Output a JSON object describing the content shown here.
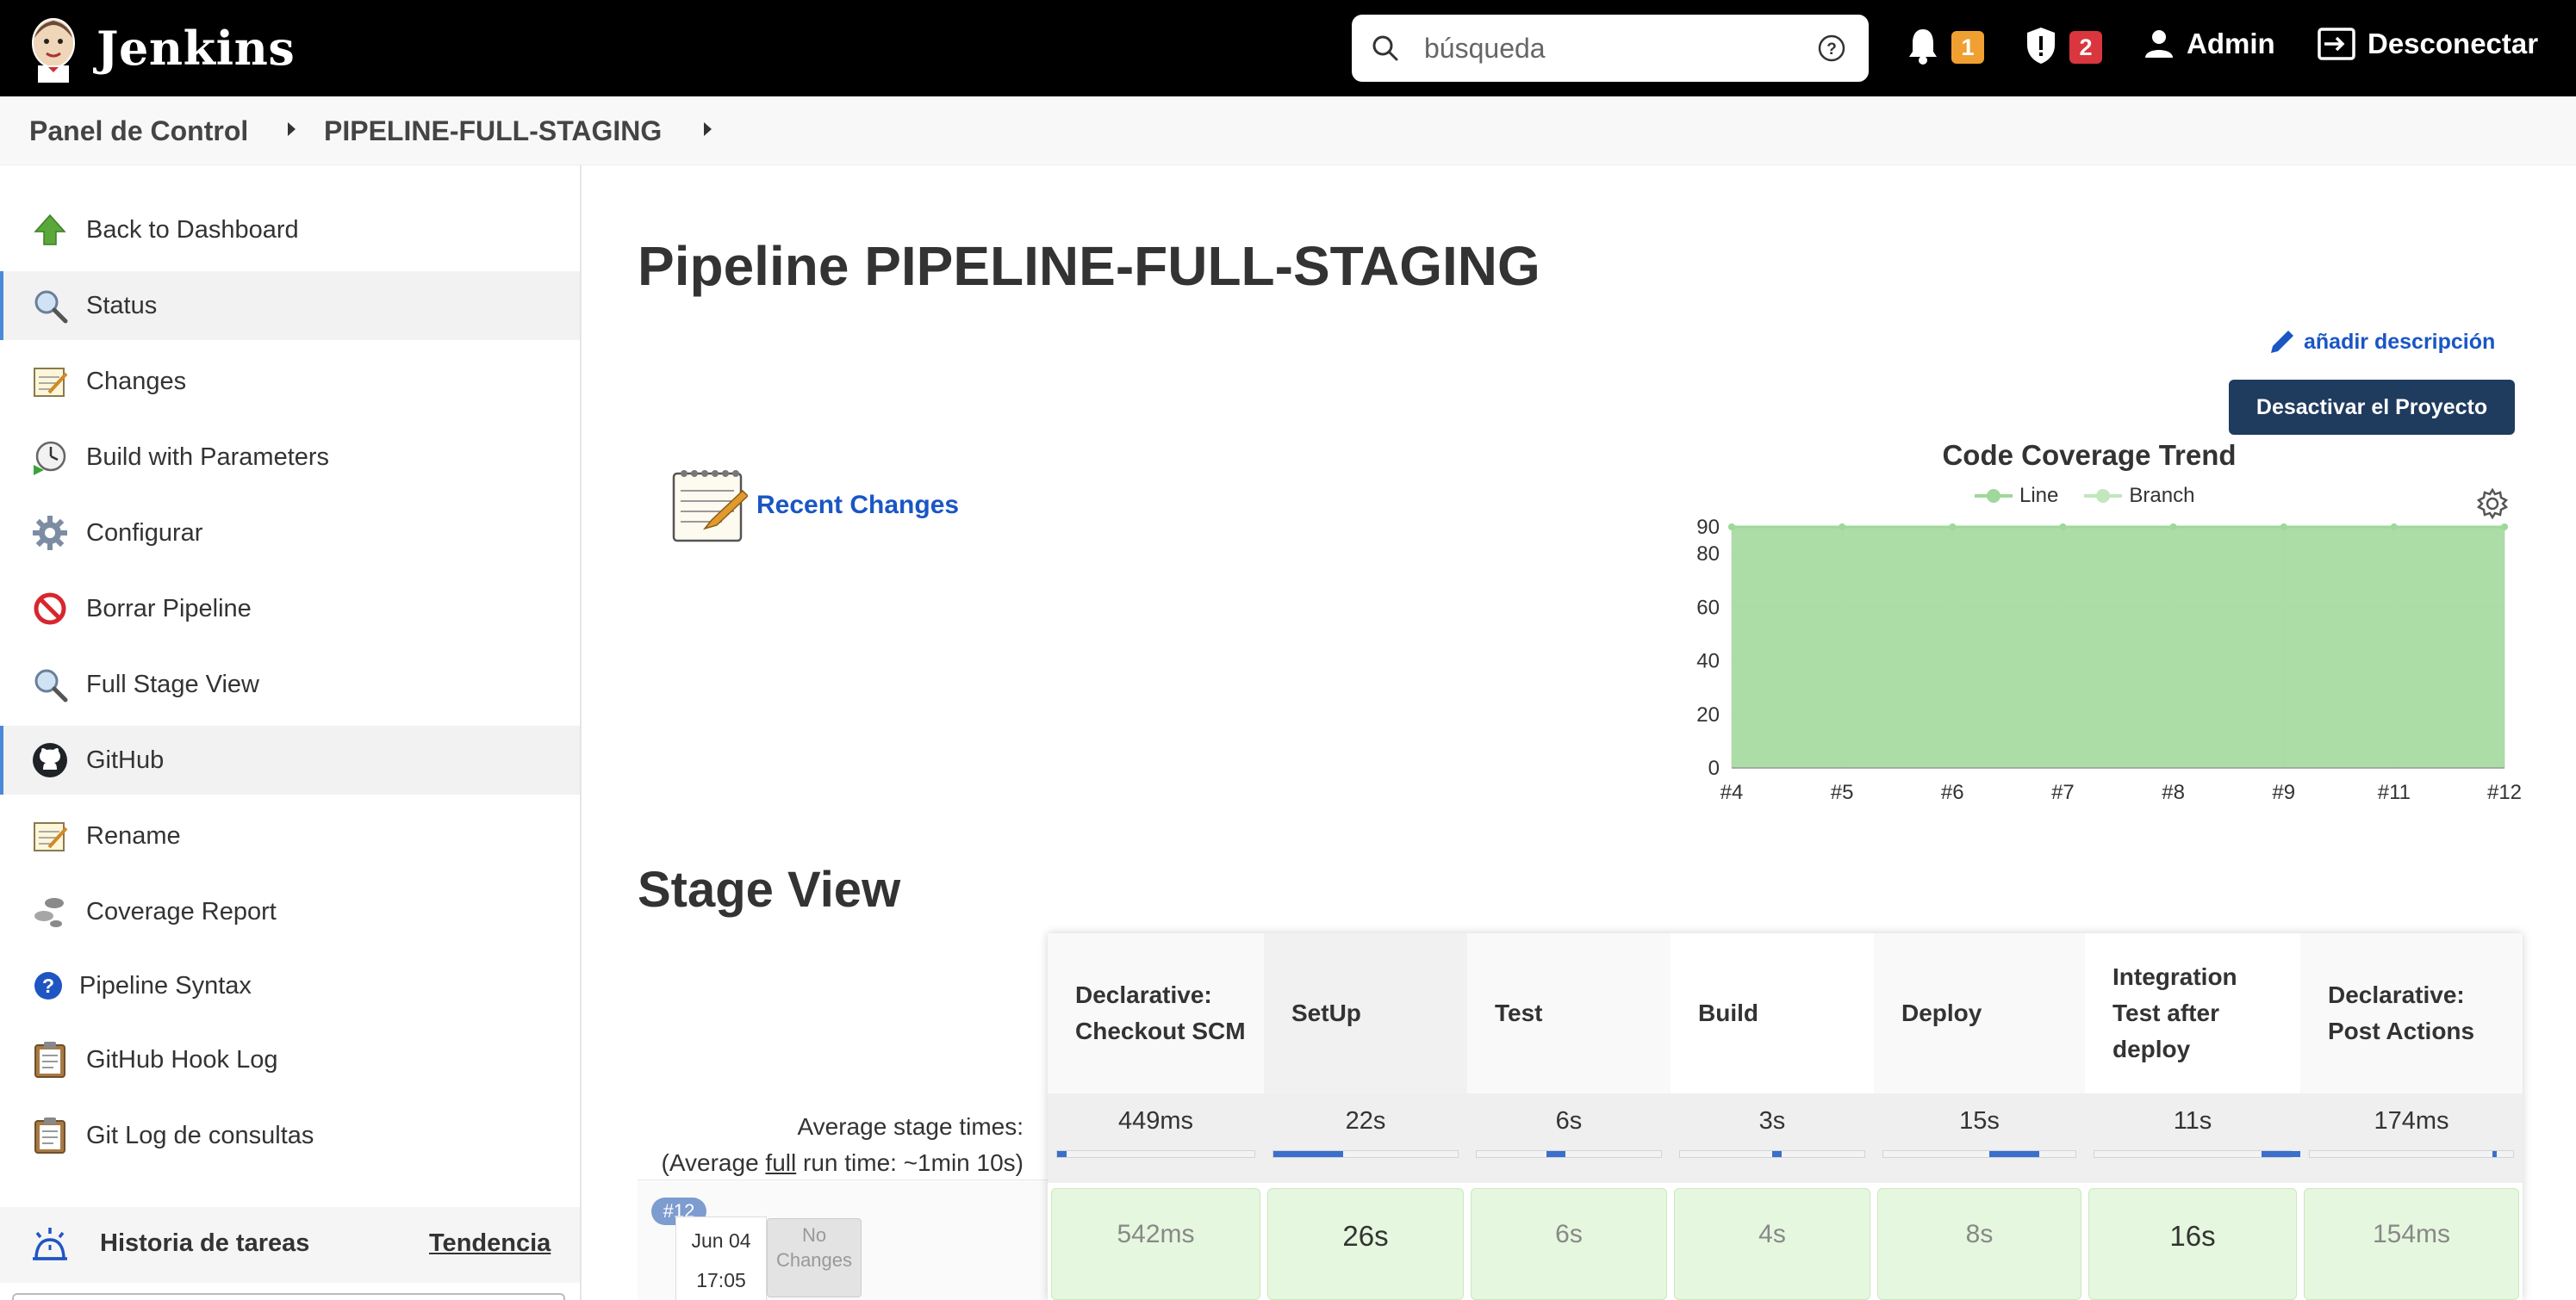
{
  "header": {
    "logo_text": "Jenkins",
    "search_placeholder": "búsqueda",
    "notifications_count": "1",
    "security_count": "2",
    "user_label": "Admin",
    "logout_label": "Desconectar",
    "notifications_color": "#f0a030",
    "security_color": "#d9363e"
  },
  "breadcrumb": {
    "items": [
      "Panel de Control",
      "PIPELINE-FULL-STAGING"
    ]
  },
  "sidebar": {
    "items": [
      {
        "label": "Back to Dashboard",
        "icon": "arrow-up-icon"
      },
      {
        "label": "Status",
        "icon": "magnifier-icon"
      },
      {
        "label": "Changes",
        "icon": "notepad-icon"
      },
      {
        "label": "Build with Parameters",
        "icon": "clock-build-icon"
      },
      {
        "label": "Configurar",
        "icon": "gear-icon"
      },
      {
        "label": "Borrar Pipeline",
        "icon": "no-entry-icon"
      },
      {
        "label": "Full Stage View",
        "icon": "magnifier-icon"
      },
      {
        "label": "GitHub",
        "icon": "github-icon"
      },
      {
        "label": "Rename",
        "icon": "notepad-icon"
      },
      {
        "label": "Coverage Report",
        "icon": "footprints-icon"
      },
      {
        "label": "Pipeline Syntax",
        "icon": "help-icon"
      },
      {
        "label": "GitHub Hook Log",
        "icon": "clipboard-icon"
      },
      {
        "label": "Git Log de consultas",
        "icon": "clipboard-icon"
      }
    ],
    "history_title": "Historia de tareas",
    "history_trend": "Tendencia"
  },
  "main": {
    "title": "Pipeline PIPELINE-FULL-STAGING",
    "add_description": "añadir descripción",
    "disable_button": "Desactivar el Proyecto",
    "recent_changes": "Recent Changes"
  },
  "chart_data": {
    "type": "area",
    "title": "Code Coverage Trend",
    "categories": [
      "#4",
      "#5",
      "#6",
      "#7",
      "#8",
      "#9",
      "#11",
      "#12"
    ],
    "series": [
      {
        "name": "Line",
        "values": [
          90,
          90,
          90,
          90,
          90,
          90,
          90,
          90
        ],
        "color": "#9fd89a"
      },
      {
        "name": "Branch",
        "values": [
          90,
          90,
          90,
          90,
          90,
          90,
          90,
          90
        ],
        "color": "#c2e6bd"
      }
    ],
    "ylim": [
      0,
      90
    ],
    "yticks": [
      0,
      20,
      40,
      60,
      80,
      90
    ],
    "grid": true,
    "legend": "top"
  },
  "stage_view": {
    "title": "Stage View",
    "avg_label_line1": "Average stage times:",
    "avg_label_line2_pre": "(Average ",
    "avg_label_line2_link": "full",
    "avg_label_line2_post": " run time: ~1min 10s)",
    "stages": [
      {
        "name": "Declarative: Checkout SCM",
        "avg": "449ms",
        "avg_fraction": 0.05,
        "run": "542ms"
      },
      {
        "name": "SetUp",
        "avg": "22s",
        "avg_fraction": 0.38,
        "run": "26s"
      },
      {
        "name": "Test",
        "avg": "6s",
        "avg_fraction": 0.1,
        "run": "6s"
      },
      {
        "name": "Build",
        "avg": "3s",
        "avg_fraction": 0.05,
        "run": "4s"
      },
      {
        "name": "Deploy",
        "avg": "15s",
        "avg_fraction": 0.26,
        "run": "8s"
      },
      {
        "name": "Integration Test after deploy",
        "avg": "11s",
        "avg_fraction": 0.2,
        "run": "16s"
      },
      {
        "name": "Declarative: Post Actions",
        "avg": "174ms",
        "avg_fraction": 0.02,
        "run": "154ms"
      }
    ],
    "build": {
      "number": "#12",
      "date": "Jun 04",
      "time": "17:05",
      "changes": "No Changes"
    }
  }
}
